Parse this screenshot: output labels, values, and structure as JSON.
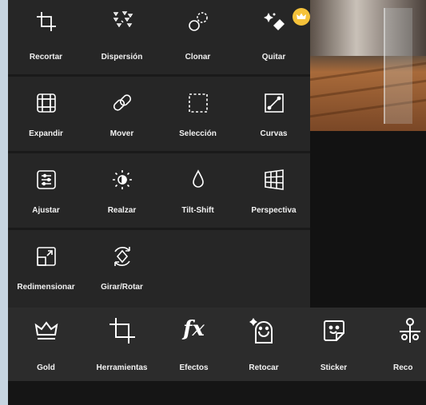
{
  "tool_panel": {
    "rows": [
      [
        {
          "label": "Recortar",
          "icon": "crop-icon"
        },
        {
          "label": "Dispersión",
          "icon": "dispersion-icon"
        },
        {
          "label": "Clonar",
          "icon": "clone-icon"
        },
        {
          "label": "Quitar",
          "icon": "eraser-sparkle-icon",
          "premium": true
        }
      ],
      [
        {
          "label": "Expandir",
          "icon": "expand-icon"
        },
        {
          "label": "Mover",
          "icon": "move-icon"
        },
        {
          "label": "Selección",
          "icon": "selection-icon"
        },
        {
          "label": "Curvas",
          "icon": "curves-icon"
        }
      ],
      [
        {
          "label": "Ajustar",
          "icon": "adjust-icon"
        },
        {
          "label": "Realzar",
          "icon": "enhance-icon"
        },
        {
          "label": "Tilt-Shift",
          "icon": "tilt-shift-icon"
        },
        {
          "label": "Perspectiva",
          "icon": "perspective-icon"
        }
      ],
      [
        {
          "label": "Redimensionar",
          "icon": "resize-icon"
        },
        {
          "label": "Girar/Rotar",
          "icon": "rotate-icon"
        }
      ]
    ]
  },
  "bottom_bar": {
    "items": [
      {
        "label": "Gold",
        "icon": "crown-icon"
      },
      {
        "label": "Herramientas",
        "icon": "crop-tools-icon"
      },
      {
        "label": "Efectos",
        "icon": "fx-icon",
        "glyph": "fx"
      },
      {
        "label": "Retocar",
        "icon": "retouch-face-icon"
      },
      {
        "label": "Sticker",
        "icon": "sticker-icon"
      },
      {
        "label": "Reco",
        "icon": "cutout-icon"
      }
    ]
  },
  "colors": {
    "panel_bg": "#262626",
    "bottom_bar_bg": "#2c2c2c",
    "premium_badge": "#f5c23a",
    "text": "#f2f2f2"
  }
}
